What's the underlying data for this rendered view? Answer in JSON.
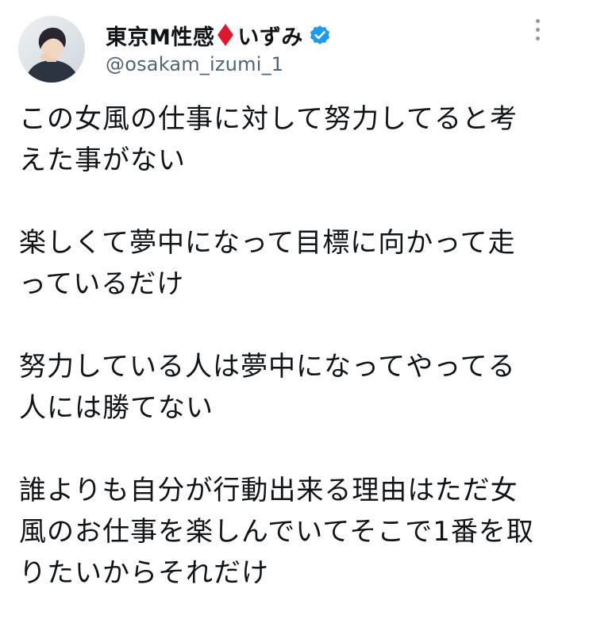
{
  "author": {
    "display_name_part1": "東京M性感",
    "display_name_part2": "いずみ",
    "handle": "@osakam_izumi_1",
    "diamond_color": "#e0182d",
    "verified_color": "#1d9bf0",
    "avatar_icon": "user-photo"
  },
  "tweet": {
    "paragraphs": [
      [
        "この女風の仕事に対して努力してると考",
        "えた事がない"
      ],
      [
        "楽しくて夢中になって目標に向かって走",
        "っているだけ"
      ],
      [
        "努力している人は夢中になってやってる",
        "人には勝てない"
      ],
      [
        "誰よりも自分が行動出来る理由はただ女",
        "風のお仕事を楽しんでいてそこで1番を取",
        "りたいからそれだけ"
      ]
    ]
  },
  "icons": {
    "more": "more-vertical-icon",
    "verified": "verified-badge-icon",
    "diamond": "red-diamond-emoji"
  }
}
